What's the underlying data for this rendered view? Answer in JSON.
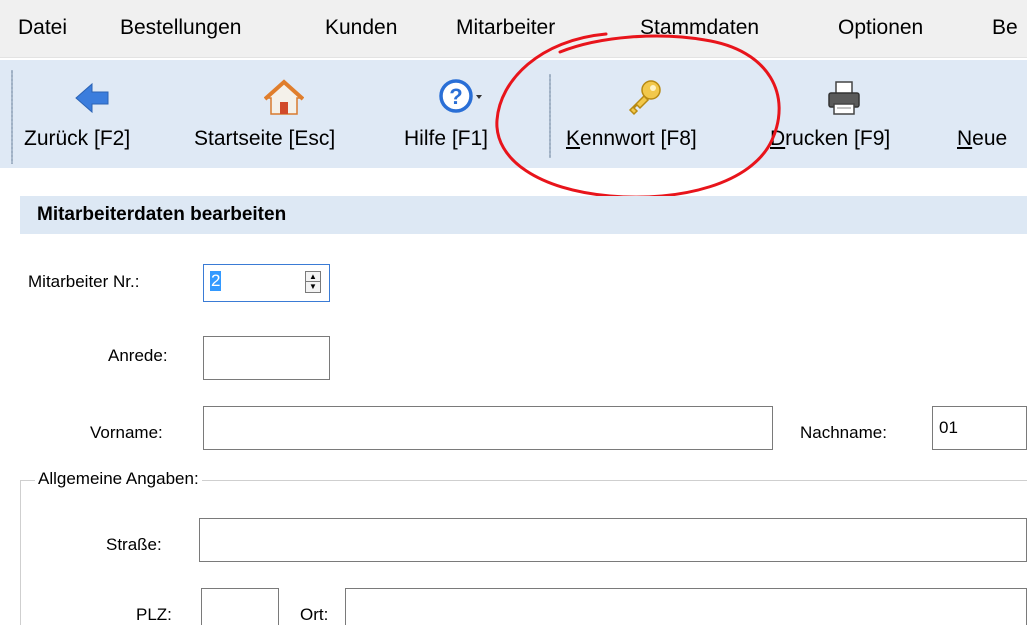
{
  "menu": {
    "items": [
      "Datei",
      "Bestellungen",
      "Kunden",
      "Mitarbeiter",
      "Stammdaten",
      "Optionen",
      "Be"
    ]
  },
  "toolbar": {
    "back_label": "Zurück [F2]",
    "home_label": "Startseite [Esc]",
    "help_label": "Hilfe [F1]",
    "password_underline": "K",
    "password_rest": "ennwort [F8]",
    "print_underline": "D",
    "print_rest": "rucken [F9]",
    "new_underline": "N",
    "new_rest": "eue"
  },
  "form": {
    "section_title": "Mitarbeiterdaten bearbeiten",
    "employee_no_label": "Mitarbeiter Nr.:",
    "employee_no_value": "2",
    "salutation_label": "Anrede:",
    "salutation_value": "",
    "firstname_label": "Vorname:",
    "firstname_value": "",
    "lastname_label": "Nachname:",
    "lastname_value": "01",
    "general_group_title": "Allgemeine Angaben:",
    "street_label": "Straße:",
    "street_value": "",
    "zip_label": "PLZ:",
    "zip_value": "",
    "city_label": "Ort:",
    "city_value": ""
  },
  "colors": {
    "toolbar_bg": "#dfe9f5",
    "section_bg": "#dde8f4",
    "annotation": "#e8141b",
    "selection": "#3399ff"
  },
  "icons": [
    "back-arrow-icon",
    "home-icon",
    "help-icon",
    "key-icon",
    "printer-icon"
  ]
}
